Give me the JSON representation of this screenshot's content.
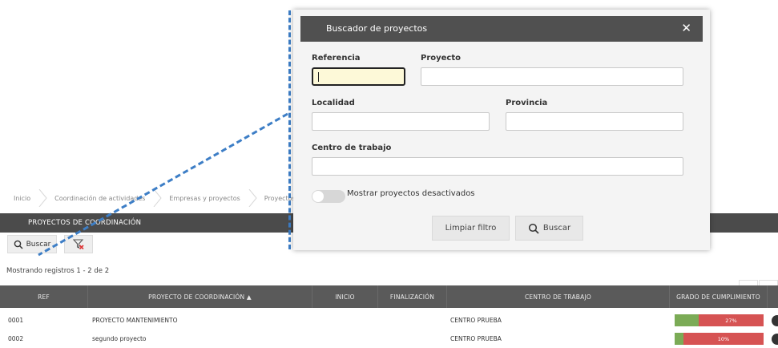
{
  "breadcrumb": [
    "Inicio",
    "Coordinación de actividades",
    "Empresas y proyectos",
    "Proyectos de c"
  ],
  "header": {
    "title": "PROYECTOS DE COORDINACIÓN"
  },
  "toolbar": {
    "search_label": "Buscar",
    "clear_filter_icon": "filter-clear-icon"
  },
  "records_text": "Mostrando registros 1 - 2 de 2",
  "pager": {
    "prev": "‹",
    "next": "›"
  },
  "table": {
    "columns": [
      "REF",
      "PROYECTO DE COORDINACIÓN ▲",
      "INICIO",
      "FINALIZACIÓN",
      "CENTRO DE TRABAJO",
      "GRADO DE CUMPLIMIENTO"
    ],
    "rows": [
      {
        "ref": "0001",
        "proyecto": "PROYECTO MANTENIMIENTO",
        "inicio": "",
        "fin": "",
        "centro": "CENTRO PRUEBA",
        "grado": "27%",
        "grado_value": 27
      },
      {
        "ref": "0002",
        "proyecto": "segundo proyecto",
        "inicio": "",
        "fin": "",
        "centro": "CENTRO PRUEBA",
        "grado": "10%",
        "grado_value": 10
      }
    ]
  },
  "modal": {
    "title": "Buscador de proyectos",
    "close": "✕",
    "fields": {
      "referencia": {
        "label": "Referencia",
        "value": ""
      },
      "proyecto": {
        "label": "Proyecto",
        "value": ""
      },
      "localidad": {
        "label": "Localidad",
        "value": ""
      },
      "provincia": {
        "label": "Provincia",
        "value": ""
      },
      "centro": {
        "label": "Centro de trabajo",
        "value": ""
      }
    },
    "toggle_label": "Mostrar proyectos desactivados",
    "clear_label": "Limpiar filtro",
    "search_label": "Buscar"
  },
  "colors": {
    "header": "#4b4b4b",
    "accent_line": "#3d7ec6",
    "progress_green": "#7bab56",
    "progress_red": "#d65353"
  }
}
